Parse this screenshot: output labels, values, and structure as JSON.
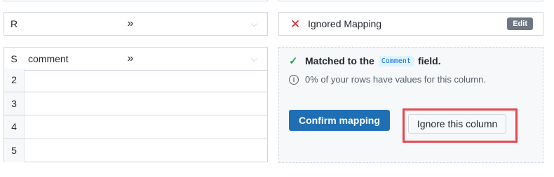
{
  "rows": [
    {
      "letter": "R",
      "column_name": "",
      "chevron": "»",
      "select_arrow": "⌵"
    },
    {
      "letter": "S",
      "column_name": "comment",
      "chevron": "»",
      "select_arrow": "⌵"
    }
  ],
  "data_rows": [
    "2",
    "3",
    "4",
    "5"
  ],
  "ignored_card": {
    "label": "Ignored Mapping",
    "edit_label": "Edit"
  },
  "matched_card": {
    "matched_prefix": "Matched to the",
    "field_code": "Comment",
    "matched_suffix": "field.",
    "info_text": "0% of your rows have values for this column.",
    "confirm_label": "Confirm mapping",
    "ignore_label": "Ignore this column"
  },
  "icons": {
    "x": "x-icon",
    "check": "check-icon",
    "info": "info-icon"
  },
  "colors": {
    "accent": "#1f6fb5",
    "error": "#cf222e",
    "success": "#2da44e",
    "highlight": "#e5484d"
  }
}
